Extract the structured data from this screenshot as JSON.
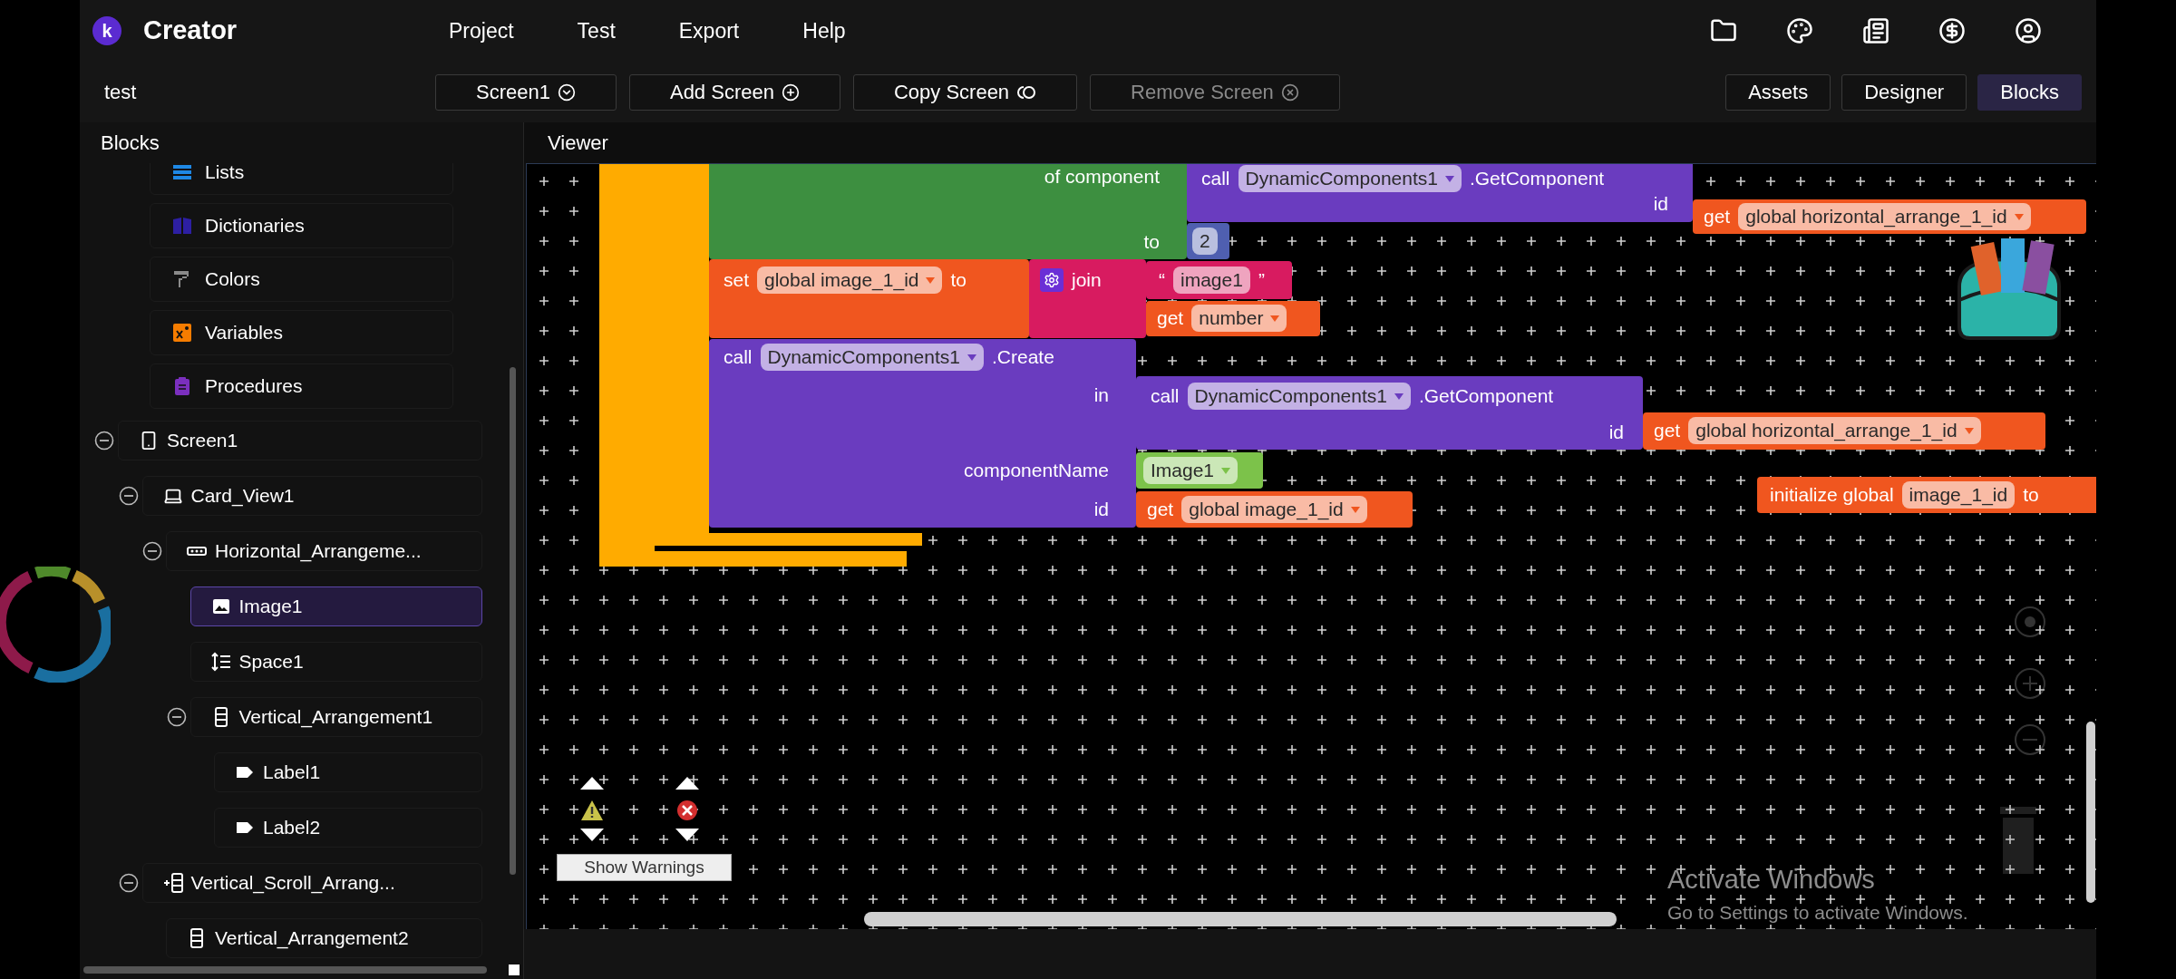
{
  "app": {
    "logo": "k",
    "name": "Creator"
  },
  "menu": [
    "Project",
    "Test",
    "Export",
    "Help"
  ],
  "project_name": "test",
  "screen_toolbar": [
    {
      "label": "Screen1",
      "kind": "dropdown",
      "disabled": false
    },
    {
      "label": "Add Screen",
      "kind": "add",
      "disabled": false
    },
    {
      "label": "Copy Screen",
      "kind": "copy",
      "disabled": false
    },
    {
      "label": "Remove Screen",
      "kind": "remove",
      "disabled": true
    }
  ],
  "view_tabs": [
    {
      "label": "Assets",
      "selected": false
    },
    {
      "label": "Designer",
      "selected": false
    },
    {
      "label": "Blocks",
      "selected": true
    }
  ],
  "sidebar": {
    "title": "Blocks",
    "categories": [
      {
        "label": "Lists",
        "kind": "lists",
        "color": "#1e88e5"
      },
      {
        "label": "Dictionaries",
        "kind": "dictionaries",
        "color": "#2d1fa3"
      },
      {
        "label": "Colors",
        "kind": "colors",
        "color": "#8a8a8a"
      },
      {
        "label": "Variables",
        "kind": "variables",
        "color": "#f57c00"
      },
      {
        "label": "Procedures",
        "kind": "procedures",
        "color": "#7b2fbe"
      }
    ],
    "tree": [
      {
        "label": "Screen1",
        "kind": "screen",
        "selected": false,
        "expanded": true,
        "children": [
          {
            "label": "Card_View1",
            "kind": "card",
            "selected": false,
            "expanded": true,
            "children": [
              {
                "label": "Horizontal_Arrangeme...",
                "kind": "horizontal",
                "selected": false,
                "expanded": true,
                "children": [
                  {
                    "label": "Image1",
                    "kind": "image",
                    "selected": true
                  },
                  {
                    "label": "Space1",
                    "kind": "space",
                    "selected": false
                  },
                  {
                    "label": "Vertical_Arrangement1",
                    "kind": "vertical",
                    "selected": false,
                    "expanded": true,
                    "children": [
                      {
                        "label": "Label1",
                        "kind": "label",
                        "selected": false
                      },
                      {
                        "label": "Label2",
                        "kind": "label",
                        "selected": false
                      }
                    ]
                  }
                ]
              }
            ]
          },
          {
            "label": "Vertical_Scroll_Arrang...",
            "kind": "scroll",
            "selected": false,
            "expanded": true,
            "children": [
              {
                "label": "Vertical_Arrangement2",
                "kind": "vertical",
                "selected": false
              }
            ]
          }
        ]
      }
    ]
  },
  "viewer": {
    "title": "Viewer",
    "blocks": [
      {
        "kind": "loop",
        "color": "#ffab00"
      },
      {
        "kind": "loop",
        "color": "#ffab00"
      },
      {
        "kind": "block",
        "color": "#3d8f40",
        "lines": [
          [
            {
              "kind": "label",
              "text": "of component"
            }
          ],
          [
            {
              "kind": "label",
              "text": "to"
            }
          ]
        ]
      },
      {
        "kind": "block",
        "color": "#6a3cbf",
        "lines": [
          [
            {
              "kind": "label",
              "text": "call"
            },
            {
              "kind": "dropdown",
              "text": "DynamicComponents1"
            },
            {
              "kind": "label",
              "text": ".GetComponent"
            }
          ],
          [
            {
              "kind": "label",
              "text": "id"
            }
          ]
        ]
      },
      {
        "kind": "block",
        "color": "#f0561f",
        "lines": [
          [
            {
              "kind": "label",
              "text": "get"
            },
            {
              "kind": "dropdown",
              "text": "global horizontal_arrange_1_id"
            }
          ]
        ]
      },
      {
        "kind": "block",
        "color": "#4f5fb0",
        "lines": [
          [
            {
              "kind": "field",
              "text": "2"
            }
          ]
        ]
      },
      {
        "kind": "block",
        "color": "#f0561f",
        "lines": [
          [
            {
              "kind": "label",
              "text": "set"
            },
            {
              "kind": "dropdown",
              "text": "global image_1_id"
            },
            {
              "kind": "label",
              "text": "to"
            }
          ]
        ]
      },
      {
        "kind": "block",
        "color": "#d81b60",
        "lines": [
          [
            {
              "kind": "icon"
            },
            {
              "kind": "label",
              "text": "join"
            }
          ]
        ]
      },
      {
        "kind": "block",
        "color": "#d81b60",
        "lines": [
          [
            {
              "kind": "label",
              "text": "“"
            },
            {
              "kind": "field",
              "text": "image1"
            },
            {
              "kind": "label",
              "text": "”"
            }
          ]
        ]
      },
      {
        "kind": "block",
        "color": "#f0561f",
        "lines": [
          [
            {
              "kind": "label",
              "text": "get"
            },
            {
              "kind": "dropdown",
              "text": "number"
            }
          ]
        ]
      },
      {
        "kind": "block",
        "color": "#6a3cbf",
        "lines": [
          [
            {
              "kind": "label",
              "text": "call"
            },
            {
              "kind": "dropdown",
              "text": "DynamicComponents1"
            },
            {
              "kind": "label",
              "text": ".Create"
            }
          ],
          [
            {
              "kind": "label",
              "text": "in"
            }
          ],
          [
            {
              "kind": "label",
              "text": "componentName"
            }
          ],
          [
            {
              "kind": "label",
              "text": "id"
            }
          ]
        ]
      },
      {
        "kind": "block",
        "color": "#6a3cbf",
        "lines": [
          [
            {
              "kind": "label",
              "text": "call"
            },
            {
              "kind": "dropdown",
              "text": "DynamicComponents1"
            },
            {
              "kind": "label",
              "text": ".GetComponent"
            }
          ],
          [
            {
              "kind": "label",
              "text": "id"
            }
          ]
        ]
      },
      {
        "kind": "block",
        "color": "#f0561f",
        "lines": [
          [
            {
              "kind": "label",
              "text": "get"
            },
            {
              "kind": "dropdown",
              "text": "global horizontal_arrange_1_id"
            }
          ]
        ]
      },
      {
        "kind": "block",
        "color": "#7cc24a",
        "lines": [
          [
            {
              "kind": "dropdown",
              "text": "Image1"
            }
          ]
        ]
      },
      {
        "kind": "block",
        "color": "#f0561f",
        "lines": [
          [
            {
              "kind": "label",
              "text": "get"
            },
            {
              "kind": "dropdown",
              "text": "global image_1_id"
            }
          ]
        ]
      },
      {
        "kind": "block",
        "color": "#f0561f",
        "lines": [
          [
            {
              "kind": "label",
              "text": "initialize global"
            },
            {
              "kind": "field",
              "text": "image_1_id"
            },
            {
              "kind": "label",
              "text": "to"
            }
          ]
        ]
      }
    ],
    "warnings_button": "Show Warnings"
  },
  "os_notice": {
    "title": "Activate Windows",
    "subtitle": "Go to Settings to activate Windows."
  }
}
